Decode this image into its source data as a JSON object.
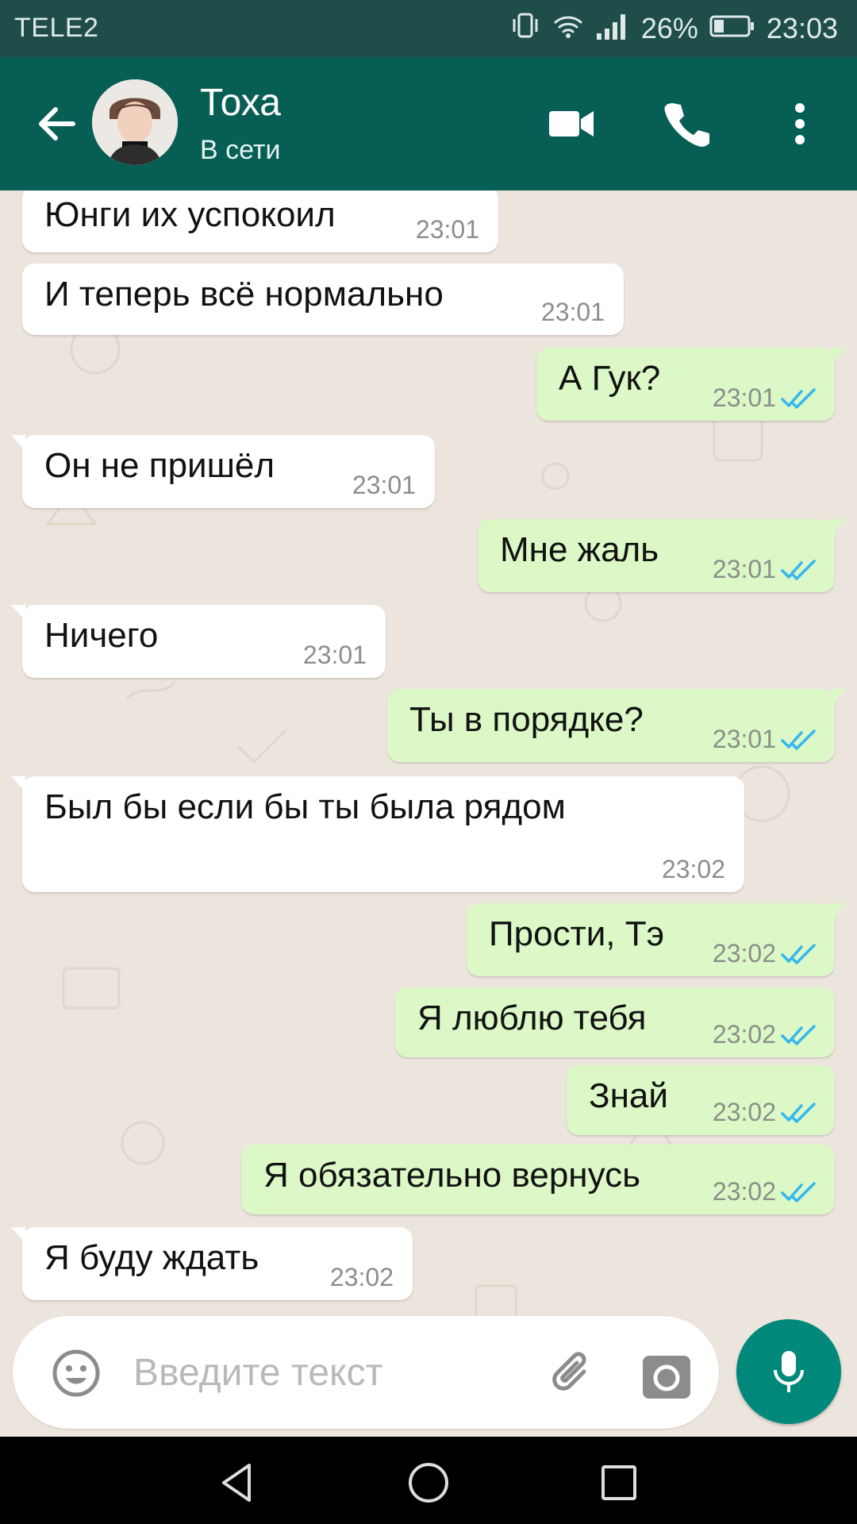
{
  "status_bar": {
    "carrier": "TELE2",
    "battery": "26%",
    "time": "23:03"
  },
  "header": {
    "contact_name": "Тоха",
    "contact_status": "В сети"
  },
  "messages": [
    {
      "dir": "in",
      "text": "Юнги их успокоил",
      "time": "23:01"
    },
    {
      "dir": "in",
      "text": "И теперь всё нормально",
      "time": "23:01"
    },
    {
      "dir": "out",
      "text": "А Гук?",
      "time": "23:01",
      "ticks": "read"
    },
    {
      "dir": "in",
      "text": "Он не пришёл",
      "time": "23:01"
    },
    {
      "dir": "out",
      "text": "Мне жаль",
      "time": "23:01",
      "ticks": "read"
    },
    {
      "dir": "in",
      "text": "Ничего",
      "time": "23:01"
    },
    {
      "dir": "out",
      "text": "Ты в порядке?",
      "time": "23:01",
      "ticks": "read"
    },
    {
      "dir": "in",
      "text": "Был бы если бы ты была рядом",
      "time": "23:02"
    },
    {
      "dir": "out",
      "text": "Прости, Тэ",
      "time": "23:02",
      "ticks": "read"
    },
    {
      "dir": "out",
      "text": "Я люблю тебя",
      "time": "23:02",
      "ticks": "read"
    },
    {
      "dir": "out",
      "text": "Знай",
      "time": "23:02",
      "ticks": "read"
    },
    {
      "dir": "out",
      "text": "Я обязательно вернусь",
      "time": "23:02",
      "ticks": "read"
    },
    {
      "dir": "in",
      "text": "Я буду ждать",
      "time": "23:02"
    }
  ],
  "input": {
    "placeholder": "Введите текст"
  },
  "colors": {
    "header": "#075e54",
    "status_bar": "#1f4d49",
    "chat_background": "#ece5dd",
    "incoming_bubble": "#ffffff",
    "outgoing_bubble": "#dcf8c6",
    "read_ticks": "#34b7f1",
    "mic_button": "#00897b"
  },
  "icons": {
    "back": "arrow-left-icon",
    "video": "video-camera-icon",
    "call": "phone-icon",
    "menu": "more-vertical-icon",
    "emoji": "smiley-icon",
    "attach": "paperclip-icon",
    "camera": "camera-icon",
    "mic": "microphone-icon"
  }
}
